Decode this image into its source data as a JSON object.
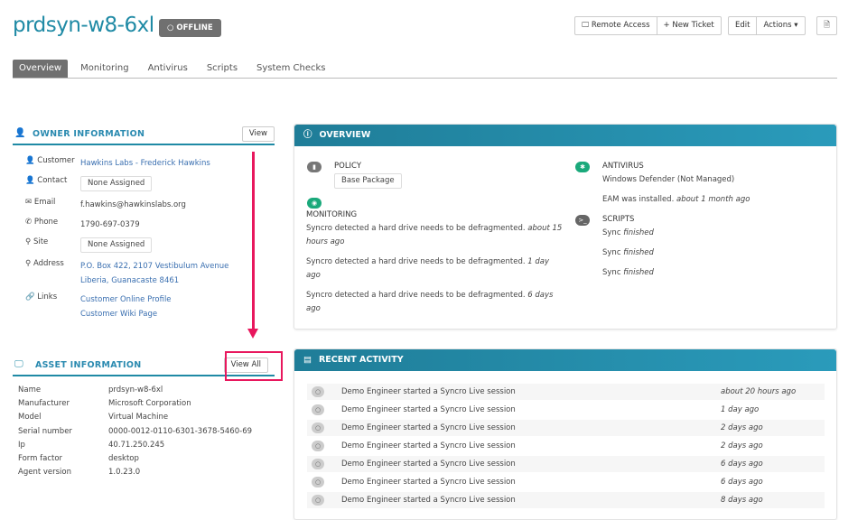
{
  "header": {
    "title": "prdsyn-w8-6xl",
    "status": "OFFLINE",
    "remote_access": "Remote Access",
    "new_ticket": "New Ticket",
    "edit": "Edit",
    "actions": "Actions"
  },
  "tabs": [
    "Overview",
    "Monitoring",
    "Antivirus",
    "Scripts",
    "System Checks"
  ],
  "owner": {
    "title": "OWNER INFORMATION",
    "view": "View",
    "rows": [
      {
        "label": "Customer",
        "value": "Hawkins Labs - Frederick Hawkins"
      },
      {
        "label": "Contact",
        "value": "None Assigned"
      },
      {
        "label": "Email",
        "value": "f.hawkins@hawkinslabs.org"
      },
      {
        "label": "Phone",
        "value": "1790-697-0379"
      },
      {
        "label": "Site",
        "value": "None Assigned"
      },
      {
        "label": "Address",
        "value": "P.O. Box 422, 2107 Vestibulum Avenue",
        "value2": "Liberia, Guanacaste 8461"
      },
      {
        "label": "Links",
        "value": "Customer Online Profile",
        "value2": "Customer Wiki Page"
      }
    ]
  },
  "asset": {
    "title": "ASSET INFORMATION",
    "view_all": "View All",
    "rows": [
      {
        "label": "Name",
        "value": "prdsyn-w8-6xl"
      },
      {
        "label": "Manufacturer",
        "value": "Microsoft Corporation"
      },
      {
        "label": "Model",
        "value": "Virtual Machine"
      },
      {
        "label": "Serial number",
        "value": "0000-0012-0110-6301-3678-5460-69"
      },
      {
        "label": "Ip",
        "value": "40.71.250.245"
      },
      {
        "label": "Form factor",
        "value": "desktop"
      },
      {
        "label": "Agent version",
        "value": "1.0.23.0"
      }
    ]
  },
  "overview": {
    "title": "OVERVIEW",
    "policy_label": "POLICY",
    "policy": "Base Package",
    "monitoring_label": "MONITORING",
    "monitoring": [
      {
        "text": "Syncro detected a hard drive needs to be defragmented.",
        "time": "about 15 hours ago"
      },
      {
        "text": "Syncro detected a hard drive needs to be defragmented.",
        "time": "1 day ago"
      },
      {
        "text": "Syncro detected a hard drive needs to be defragmented.",
        "time": "6 days ago"
      }
    ],
    "antivirus_label": "ANTIVIRUS",
    "antivirus": "Windows Defender (Not Managed)",
    "eam": "EAM was installed.",
    "eam_time": "about 1 month ago",
    "scripts_label": "SCRIPTS",
    "scripts": [
      {
        "name": "Sync",
        "status": "finished"
      },
      {
        "name": "Sync",
        "status": "finished"
      },
      {
        "name": "Sync",
        "status": "finished"
      }
    ]
  },
  "activity": {
    "title": "RECENT ACTIVITY",
    "items": [
      {
        "text": "Demo Engineer started a Syncro Live session",
        "time": "about 20 hours ago"
      },
      {
        "text": "Demo Engineer started a Syncro Live session",
        "time": "1 day ago"
      },
      {
        "text": "Demo Engineer started a Syncro Live session",
        "time": "2 days ago"
      },
      {
        "text": "Demo Engineer started a Syncro Live session",
        "time": "2 days ago"
      },
      {
        "text": "Demo Engineer started a Syncro Live session",
        "time": "6 days ago"
      },
      {
        "text": "Demo Engineer started a Syncro Live session",
        "time": "6 days ago"
      },
      {
        "text": "Demo Engineer started a Syncro Live session",
        "time": "8 days ago"
      }
    ]
  },
  "colors": {
    "accent": "#1f8aa5",
    "annotation": "#e8175d",
    "green": "#1aa97b"
  }
}
